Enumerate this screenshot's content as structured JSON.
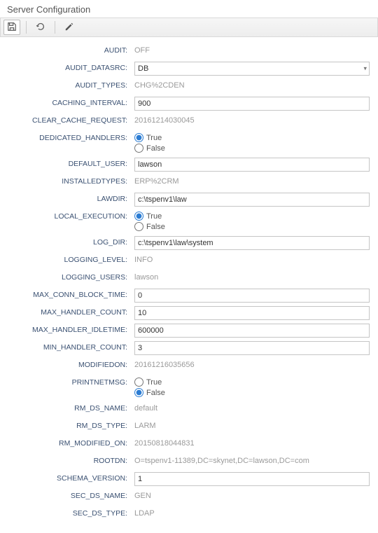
{
  "title": "Server Configuration",
  "labels": {
    "true": "True",
    "false": "False"
  },
  "fields": {
    "audit": {
      "label": "AUDIT:",
      "value": "OFF"
    },
    "audit_datasrc": {
      "label": "AUDIT_DATASRC:",
      "value": "DB"
    },
    "audit_types": {
      "label": "AUDIT_TYPES:",
      "value": "CHG%2CDEN"
    },
    "caching_interval": {
      "label": "CACHING_INTERVAL:",
      "value": "900"
    },
    "clear_cache_request": {
      "label": "CLEAR_CACHE_REQUEST:",
      "value": "20161214030045"
    },
    "dedicated_handlers": {
      "label": "DEDICATED_HANDLERS:",
      "value": "true"
    },
    "default_user": {
      "label": "DEFAULT_USER:",
      "value": "lawson"
    },
    "installedtypes": {
      "label": "INSTALLEDTYPES:",
      "value": "ERP%2CRM"
    },
    "lawdir": {
      "label": "LAWDIR:",
      "value": "c:\\tspenv1\\law"
    },
    "local_execution": {
      "label": "LOCAL_EXECUTION:",
      "value": "true"
    },
    "log_dir": {
      "label": "LOG_DIR:",
      "value": "c:\\tspenv1\\law\\system"
    },
    "logging_level": {
      "label": "LOGGING_LEVEL:",
      "value": "INFO"
    },
    "logging_users": {
      "label": "LOGGING_USERS:",
      "value": "lawson"
    },
    "max_conn_block_time": {
      "label": "MAX_CONN_BLOCK_TIME:",
      "value": "0"
    },
    "max_handler_count": {
      "label": "MAX_HANDLER_COUNT:",
      "value": "10"
    },
    "max_handler_idletime": {
      "label": "MAX_HANDLER_IDLETIME:",
      "value": "600000"
    },
    "min_handler_count": {
      "label": "MIN_HANDLER_COUNT:",
      "value": "3"
    },
    "modifiedon": {
      "label": "MODIFIEDON:",
      "value": "20161216035656"
    },
    "printnetmsg": {
      "label": "PRINTNETMSG:",
      "value": "false"
    },
    "rm_ds_name": {
      "label": "RM_DS_NAME:",
      "value": "default"
    },
    "rm_ds_type": {
      "label": "RM_DS_TYPE:",
      "value": "LARM"
    },
    "rm_modified_on": {
      "label": "RM_MODIFIED_ON:",
      "value": "20150818044831"
    },
    "rootdn": {
      "label": "ROOTDN:",
      "value": "O=tspenv1-11389,DC=skynet,DC=lawson,DC=com"
    },
    "schema_version": {
      "label": "SCHEMA_VERSION:",
      "value": "1"
    },
    "sec_ds_name": {
      "label": "SEC_DS_NAME:",
      "value": "GEN"
    },
    "sec_ds_type": {
      "label": "SEC_DS_TYPE:",
      "value": "LDAP"
    }
  }
}
